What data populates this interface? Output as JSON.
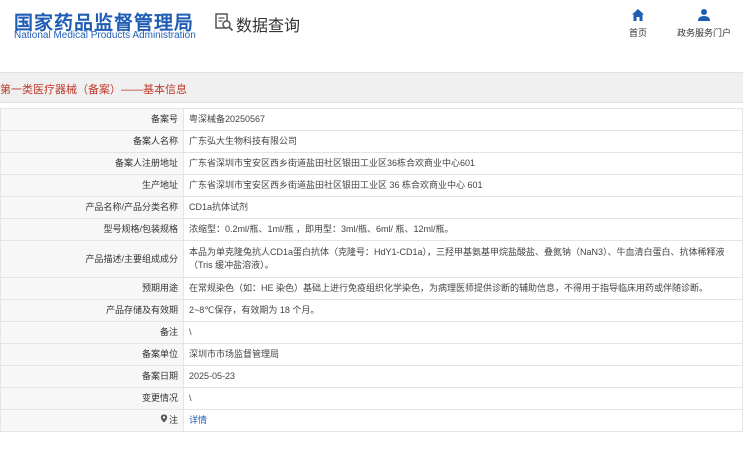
{
  "header": {
    "logo_cn": "国家药品监督管理局",
    "logo_en": "National Medical Products Administration",
    "query_title": "数据查询",
    "nav": [
      {
        "label": "首页",
        "icon": "home-icon"
      },
      {
        "label": "政务服务门户",
        "icon": "user-icon"
      }
    ]
  },
  "section": {
    "title": "第一类医疗器械（备案）——基本信息"
  },
  "rows": [
    {
      "label": "备案号",
      "value": "粤深械备20250567"
    },
    {
      "label": "备案人名称",
      "value": "广东弘大生物科技有限公司"
    },
    {
      "label": "备案人注册地址",
      "value": "广东省深圳市宝安区西乡街道盐田社区银田工业区36栋合欢商业中心601"
    },
    {
      "label": "生产地址",
      "value": "广东省深圳市宝安区西乡街道盐田社区银田工业区 36 栋合欢商业中心 601"
    },
    {
      "label": "产品名称/产品分类名称",
      "value": "CD1a抗体试剂"
    },
    {
      "label": "型号规格/包装规格",
      "value": "浓缩型：0.2ml/瓶、1ml/瓶 ，即用型：3ml/瓶、6ml/ 瓶、12ml/瓶。"
    },
    {
      "label": "产品描述/主要组成成分",
      "value": "本品为单克隆兔抗人CD1a蛋白抗体（克隆号：HdY1-CD1a），三羟甲基氨基甲烷盐酸盐、叠氮钠（NaN3）、牛血清白蛋白、抗体稀释液（Tris 缓冲盐溶液）。"
    },
    {
      "label": "预期用途",
      "value": "在常规染色（如：HE 染色）基础上进行免疫组织化学染色，为病理医师提供诊断的辅助信息，不得用于指导临床用药或伴随诊断。"
    },
    {
      "label": "产品存储及有效期",
      "value": "2~8℃保存，有效期为 18 个月。"
    },
    {
      "label": "备注",
      "value": "\\"
    },
    {
      "label": "备案单位",
      "value": "深圳市市场监督管理局"
    },
    {
      "label": "备案日期",
      "value": "2025-05-23"
    },
    {
      "label": "变更情况",
      "value": "\\"
    }
  ],
  "note_row": {
    "label": "注",
    "link": "详情"
  },
  "colors": {
    "brand_blue": "#1f5db5",
    "section_red": "#c0392b"
  }
}
